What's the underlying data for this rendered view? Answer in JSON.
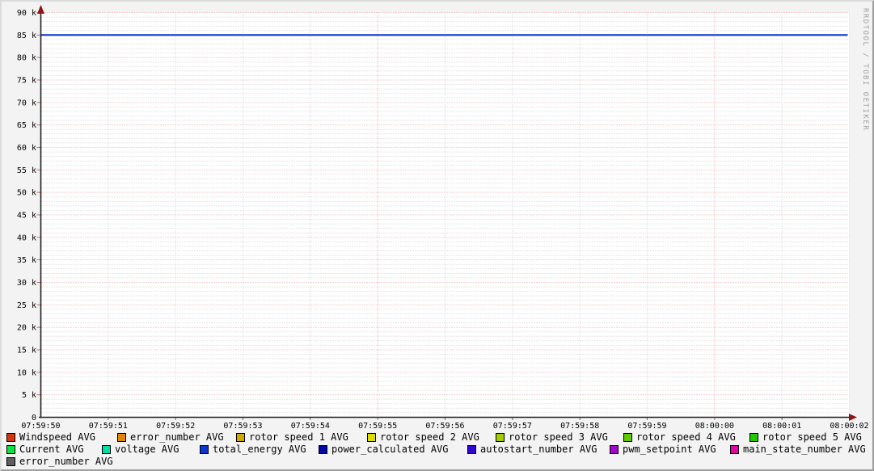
{
  "watermark": "RRDTOOL / TOBI OETIKER",
  "colors": {
    "background": "#f3f3f3",
    "canvas": "#ffffff",
    "axis": "#1f1f1f",
    "arrow": "#8e1616",
    "grid_major": "#f2a0a0",
    "grid_minor": "#cfcfcf",
    "tick_major": "#c06a6a",
    "tick_minor": "#6b6b6b",
    "watermark": "#a0a0a0",
    "series_line": "#0d35d0"
  },
  "chart_data": {
    "type": "line",
    "title": "",
    "x_axis": {
      "tick_labels": [
        "07:59:50",
        "07:59:51",
        "07:59:52",
        "07:59:53",
        "07:59:54",
        "07:59:55",
        "07:59:56",
        "07:59:57",
        "07:59:58",
        "07:59:59",
        "08:00:00",
        "08:00:01",
        "08:00:02"
      ],
      "major_gridlines": [
        "07:59:55",
        "08:00:00"
      ],
      "minor_step_seconds": 1
    },
    "y_axis": {
      "min": 0,
      "max": 90000,
      "major_step": 5000,
      "minor_step": 1000,
      "tick_labels": [
        "0",
        "5 k",
        "10 k",
        "15 k",
        "20 k",
        "25 k",
        "30 k",
        "35 k",
        "40 k",
        "45 k",
        "50 k",
        "55 k",
        "60 k",
        "65 k",
        "70 k",
        "75 k",
        "80 k",
        "85 k",
        "90 k"
      ]
    },
    "series": [
      {
        "name": "total_energy AVG",
        "color": "#0d35d0",
        "x": [
          "07:59:50",
          "08:00:02"
        ],
        "y": [
          85000,
          85000
        ],
        "note": "constant horizontal line at 85 k across full time range"
      }
    ]
  },
  "legend": {
    "rows": [
      {
        "items": [
          {
            "label": "Windspeed AVG",
            "color": "#d7350a"
          },
          {
            "label": "error_number AVG",
            "color": "#dd8800"
          },
          {
            "label": "rotor speed 1 AVG",
            "color": "#d1a700"
          },
          {
            "label": "rotor speed 2 AVG",
            "color": "#dddd00"
          },
          {
            "label": "rotor speed 3 AVG",
            "color": "#a3cc02"
          },
          {
            "label": "rotor speed 4 AVG",
            "color": "#5ecb02"
          },
          {
            "label": "rotor speed 5 AVG",
            "color": "#22c802"
          }
        ]
      },
      {
        "items": [
          {
            "label": "Current AVG",
            "color": "#0ae442"
          },
          {
            "label": "voltage AVG",
            "color": "#00dda2"
          },
          {
            "label": "total_energy AVG",
            "color": "#0a36d4"
          },
          {
            "label": "power_calculated AVG",
            "color": "#0104a8"
          },
          {
            "label": "autostart_number AVG",
            "color": "#3305d2"
          },
          {
            "label": "pwm_setpoint AVG",
            "color": "#a008cc"
          },
          {
            "label": "main_state_number AVG",
            "color": "#e008a0"
          }
        ]
      },
      {
        "items": [
          {
            "label": "error_number AVG",
            "color": "#5f5f5f"
          }
        ]
      }
    ]
  }
}
